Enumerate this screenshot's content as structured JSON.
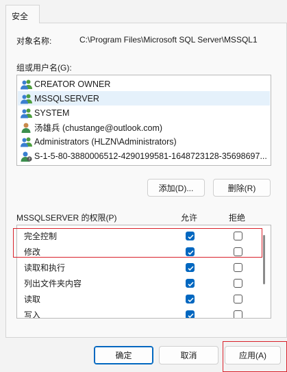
{
  "tab": {
    "label": "安全"
  },
  "object": {
    "label": "对象名称:",
    "value": "C:\\Program Files\\Microsoft SQL Server\\MSSQL1"
  },
  "groups": {
    "label": "组或用户名(G):",
    "items": [
      {
        "name": "CREATOR OWNER",
        "icon": "user-group-icon"
      },
      {
        "name": "MSSQLSERVER",
        "icon": "user-group-icon"
      },
      {
        "name": "SYSTEM",
        "icon": "user-group-icon"
      },
      {
        "name": "汤雄兵 (chustange@outlook.com)",
        "icon": "user-icon"
      },
      {
        "name": "Administrators (HLZN\\Administrators)",
        "icon": "user-group-icon"
      },
      {
        "name": "S-1-5-80-3880006512-4290199581-1648723128-35698697...",
        "icon": "unknown-user-icon"
      }
    ],
    "selected": "MSSQLSERVER"
  },
  "actions": {
    "add": "添加(D)...",
    "remove": "删除(R)"
  },
  "permissions": {
    "title": "MSSQLSERVER 的权限(P)",
    "allow_header": "允许",
    "deny_header": "拒绝",
    "rows": [
      {
        "label": "完全控制",
        "allow": true,
        "deny": false
      },
      {
        "label": "修改",
        "allow": true,
        "deny": false
      },
      {
        "label": "读取和执行",
        "allow": true,
        "deny": false
      },
      {
        "label": "列出文件夹内容",
        "allow": true,
        "deny": false
      },
      {
        "label": "读取",
        "allow": true,
        "deny": false
      },
      {
        "label": "写入",
        "allow": true,
        "deny": false
      }
    ]
  },
  "footer": {
    "ok": "确定",
    "cancel": "取消",
    "apply": "应用(A)"
  },
  "colors": {
    "accent": "#0067c0",
    "highlight": "#d9202a",
    "selection": "#e5f1fb"
  }
}
